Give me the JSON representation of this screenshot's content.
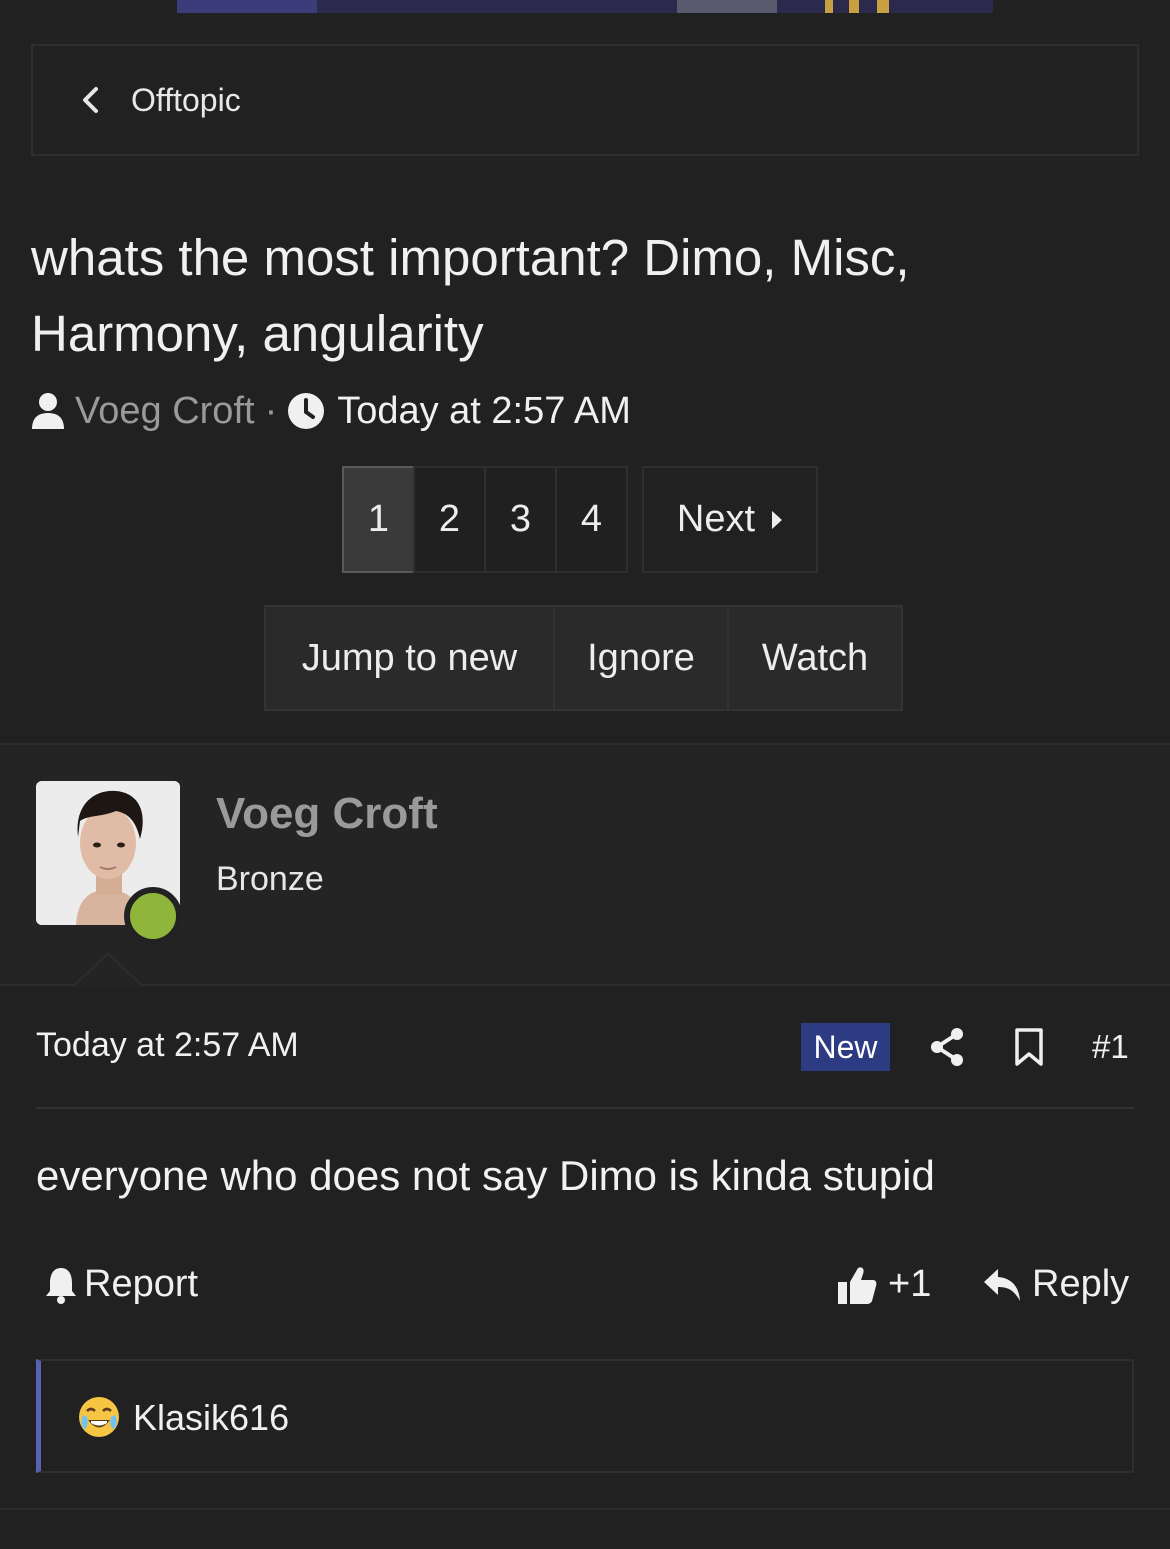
{
  "breadcrumb": {
    "label": "Offtopic"
  },
  "thread": {
    "title": "whats the most important? Dimo, Misc, Harmony, angularity",
    "author": "Voeg Croft",
    "separator": "·",
    "time": "Today at 2:57 AM"
  },
  "pagination": {
    "pages": [
      "1",
      "2",
      "3",
      "4"
    ],
    "current": "1",
    "next_label": "Next"
  },
  "actions": {
    "jump": "Jump to new",
    "ignore": "Ignore",
    "watch": "Watch"
  },
  "post": {
    "user": {
      "name": "Voeg Croft",
      "rank": "Bronze",
      "online": true
    },
    "time": "Today at 2:57 AM",
    "badge": "New",
    "number": "#1",
    "body": "everyone who does not say Dimo is kinda stupid",
    "report_label": "Report",
    "like_label": "+1",
    "reply_label": "Reply",
    "reactions": {
      "user": "Klasik616",
      "emoji": "tears-of-joy"
    }
  },
  "colors": {
    "background": "#212121",
    "badge_new": "#2d3b82",
    "online": "#8fb63a",
    "reaction_bar": "#5863b3"
  }
}
